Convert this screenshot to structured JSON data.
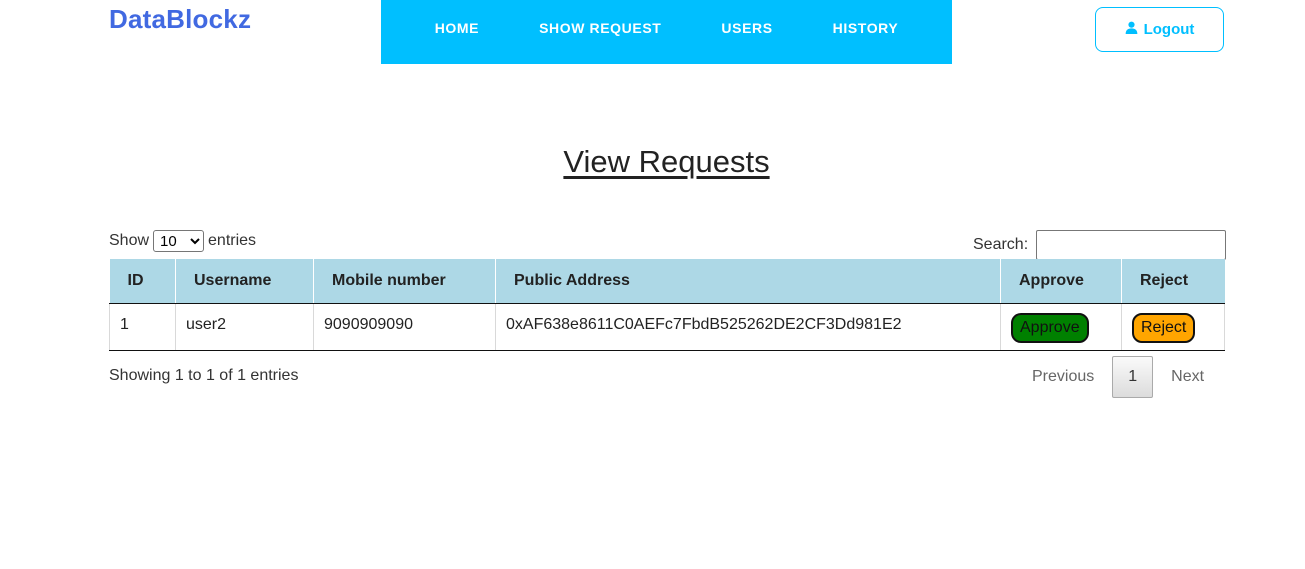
{
  "brand": "DataBlockz",
  "nav": {
    "items": [
      {
        "label": "HOME"
      },
      {
        "label": "SHOW REQUEST"
      },
      {
        "label": "USERS"
      },
      {
        "label": "HISTORY"
      }
    ],
    "logout_label": "Logout",
    "color": "#00bfff"
  },
  "page_title": "View Requests",
  "length_control": {
    "prefix": "Show",
    "selected": "10",
    "suffix": "entries"
  },
  "search": {
    "label": "Search:",
    "value": ""
  },
  "table": {
    "columns": [
      "ID",
      "Username",
      "Mobile number",
      "Public Address",
      "Approve",
      "Reject"
    ],
    "rows": [
      {
        "id": "1",
        "username": "user2",
        "mobile": "9090909090",
        "address": "0xAF638e8611C0AEFc7FbdB525262DE2CF3Dd981E2",
        "approve_label": "Approve",
        "reject_label": "Reject"
      }
    ],
    "header_color": "#add8e6",
    "approve_color": "#008000",
    "reject_color": "#ffa500"
  },
  "info_text": "Showing 1 to 1 of 1 entries",
  "pagination": {
    "previous": "Previous",
    "current": "1",
    "next": "Next"
  }
}
